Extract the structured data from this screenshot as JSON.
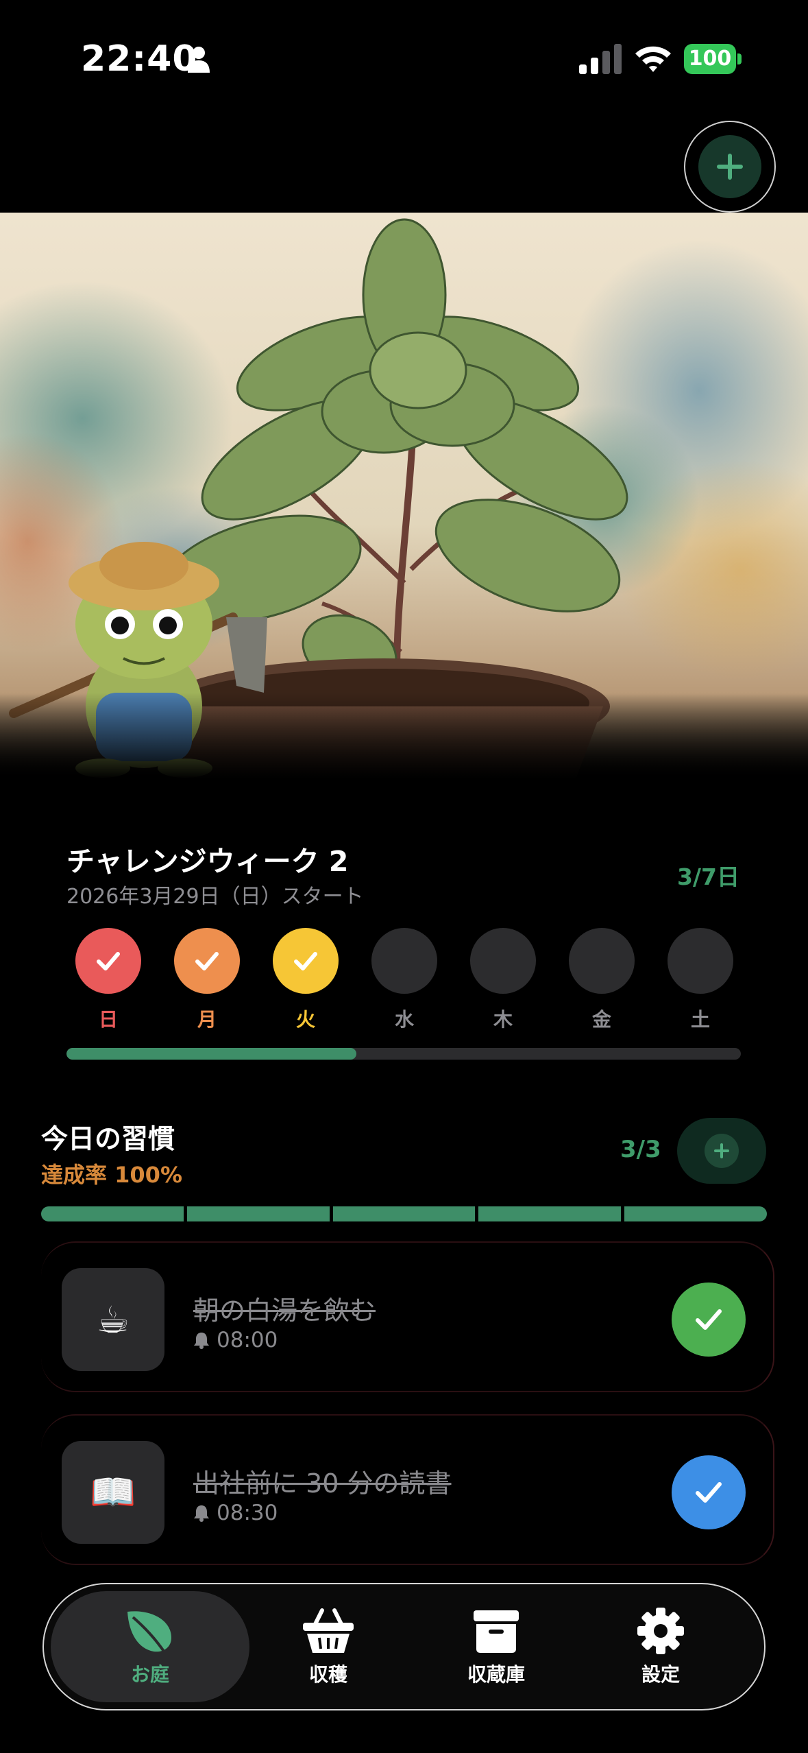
{
  "status_bar": {
    "time": "22:40",
    "battery": "100"
  },
  "challenge": {
    "title": "チャレンジウィーク 2",
    "subtitle": "2026年3月29日（日）スタート",
    "count": "3/7日",
    "progress": 0.43,
    "days": [
      {
        "label": "日",
        "done": true,
        "color": "#e95a5a"
      },
      {
        "label": "月",
        "done": true,
        "color": "#ee8f4e"
      },
      {
        "label": "火",
        "done": true,
        "color": "#f6c636"
      },
      {
        "label": "水",
        "done": false
      },
      {
        "label": "木",
        "done": false
      },
      {
        "label": "金",
        "done": false
      },
      {
        "label": "土",
        "done": false
      }
    ]
  },
  "habits": {
    "title": "今日の習慣",
    "rate": "達成率 100%",
    "count": "3/3",
    "items": [
      {
        "icon": "☕",
        "name": "朝の白湯を飲む",
        "time": "08:00",
        "check_color": "#4caf50"
      },
      {
        "icon": "📖",
        "name": "出社前に 30 分の読書",
        "time": "08:30",
        "check_color": "#3d8fe6"
      }
    ]
  },
  "tabbar": {
    "tabs": [
      {
        "label": "お庭",
        "icon": "leaf-icon",
        "active": true
      },
      {
        "label": "収穫",
        "icon": "basket-icon",
        "active": false
      },
      {
        "label": "収蔵庫",
        "icon": "archive-box-icon",
        "active": false
      },
      {
        "label": "設定",
        "icon": "gear-icon",
        "active": false
      }
    ]
  },
  "colors": {
    "accent_green": "#3e8e68",
    "rate_orange": "#d8893a"
  }
}
